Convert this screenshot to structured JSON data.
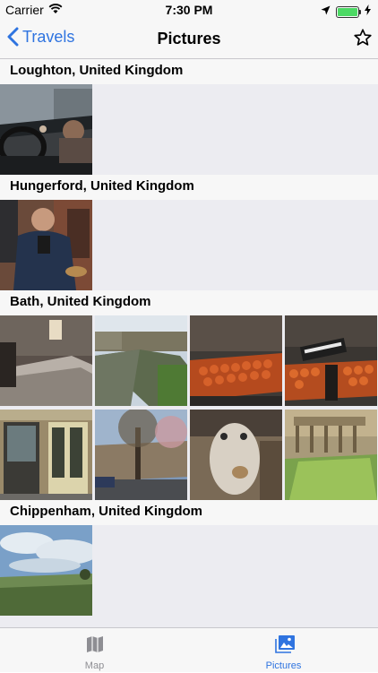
{
  "status_bar": {
    "carrier": "Carrier",
    "time": "7:30 PM"
  },
  "nav": {
    "back_label": "Travels",
    "title": "Pictures"
  },
  "sections": [
    {
      "title": "Loughton, United Kingdom"
    },
    {
      "title": "Hungerford, United Kingdom"
    },
    {
      "title": "Bath, United Kingdom"
    },
    {
      "title": "Chippenham, United Kingdom"
    }
  ],
  "tabs": [
    {
      "label": "Map",
      "icon": "map-icon",
      "selected": false
    },
    {
      "label": "Pictures",
      "icon": "photo-icon",
      "selected": true
    }
  ],
  "colors": {
    "accent": "#2f74e0",
    "inactive_tab": "#8e8e93",
    "battery": "#4cd964"
  }
}
